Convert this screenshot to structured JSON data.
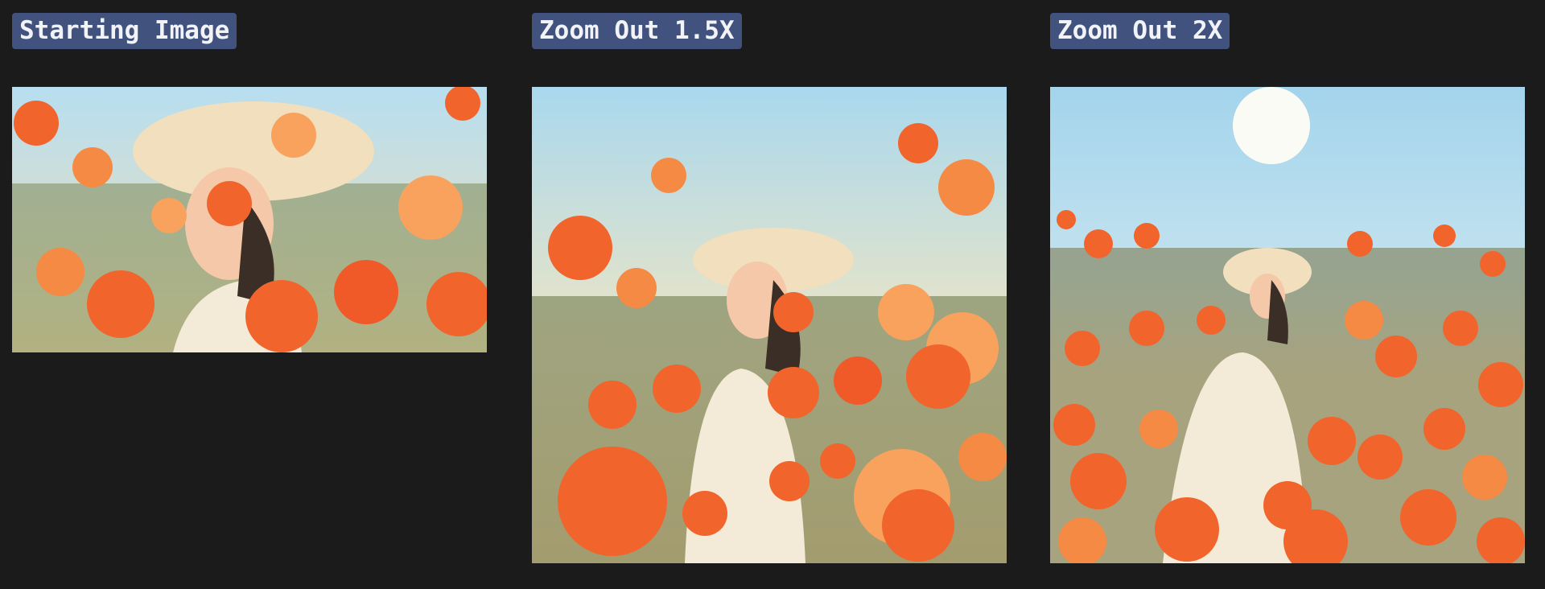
{
  "panels": [
    {
      "label": "Starting Image",
      "image": "girl-in-poppy-field-original"
    },
    {
      "label": "Zoom Out 1.5X",
      "image": "girl-in-poppy-field-zoom-1.5x"
    },
    {
      "label": "Zoom Out 2X",
      "image": "girl-in-poppy-field-zoom-2x"
    }
  ],
  "colors": {
    "background": "#1b1b1c",
    "label_bg": "#41527f",
    "label_text": "#f2f3f7",
    "sky": "#a9d8ee",
    "poppy": "#f1642c",
    "poppy_light": "#f8a25e",
    "foliage": "#6f7a4f",
    "hat": "#f1dfbd",
    "dress": "#f4ead8"
  }
}
